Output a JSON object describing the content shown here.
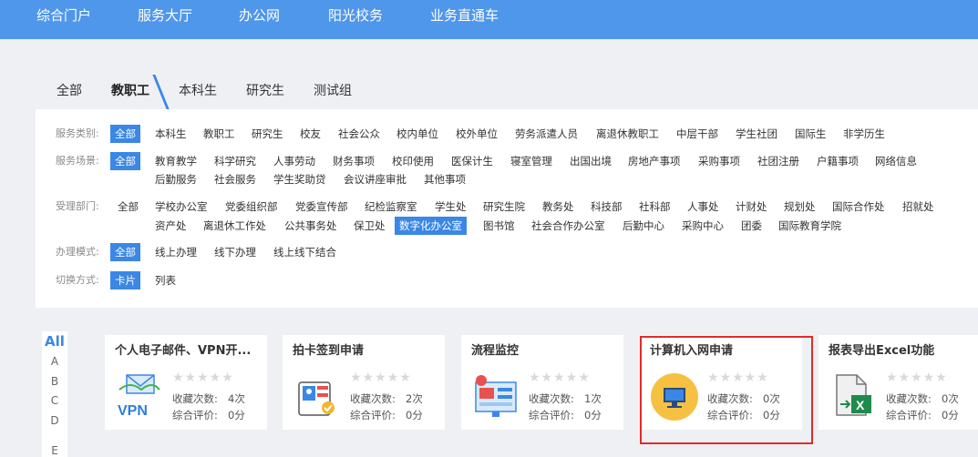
{
  "topnav": {
    "items": [
      "综合门户",
      "服务大厅",
      "办公网",
      "阳光校务",
      "业务直通车"
    ]
  },
  "tabs": [
    "全部",
    "教职工",
    "本科生",
    "研究生",
    "测试组"
  ],
  "filters": {
    "service_category": {
      "label": "服务类别:",
      "options": [
        "全部",
        "本科生",
        "教职工",
        "研究生",
        "校友",
        "社会公众",
        "校内单位",
        "校外单位",
        "劳务派遣人员",
        "离退休教职工",
        "中层干部",
        "学生社团",
        "国际生",
        "非学历生"
      ]
    },
    "service_scene": {
      "label": "服务场景:",
      "options": [
        "全部",
        "教育教学",
        "科学研究",
        "人事劳动",
        "财务事项",
        "校印使用",
        "医保计生",
        "寝室管理",
        "出国出境",
        "房地产事项",
        "采购事项",
        "社团注册",
        "户籍事项",
        "网络信息",
        "后勤服务",
        "社会服务",
        "学生奖助贷",
        "会议讲座审批",
        "其他事项"
      ]
    },
    "department": {
      "label": "受理部门:",
      "options": [
        "全部",
        "学校办公室",
        "党委组织部",
        "党委宣传部",
        "纪检监察室",
        "学生处",
        "研究生院",
        "教务处",
        "科技部",
        "社科部",
        "人事处",
        "计财处",
        "规划处",
        "国际合作处",
        "招就处",
        "资产处",
        "离退休工作处",
        "公共事务处",
        "保卫处",
        "数字化办公室",
        "图书馆",
        "社会合作办公室",
        "后勤中心",
        "采购中心",
        "团委",
        "国际教育学院"
      ]
    },
    "mode": {
      "label": "办理模式:",
      "options": [
        "全部",
        "线上办理",
        "线下办理",
        "线上线下结合"
      ]
    },
    "view": {
      "label": "切换方式:",
      "options": [
        "卡片",
        "列表"
      ]
    }
  },
  "alphabet": [
    "All",
    "A",
    "B",
    "C",
    "D",
    "E"
  ],
  "cards": [
    {
      "title": "个人电子邮件、VPN开...",
      "icon": "vpn-mail-icon",
      "stars": "★★★★★",
      "fav_label": "收藏次数:",
      "fav_value": "4次",
      "rate_label": "综合评价:",
      "rate_value": "0分"
    },
    {
      "title": "拍卡签到申请",
      "icon": "sign-in-card-icon",
      "stars": "★★★★★",
      "fav_label": "收藏次数:",
      "fav_value": "2次",
      "rate_label": "综合评价:",
      "rate_value": "0分"
    },
    {
      "title": "流程监控",
      "icon": "process-monitor-icon",
      "stars": "★★★★★",
      "fav_label": "收藏次数:",
      "fav_value": "1次",
      "rate_label": "综合评价:",
      "rate_value": "0分"
    },
    {
      "title": "计算机入网申请",
      "icon": "computer-network-icon",
      "stars": "★★★★★",
      "fav_label": "收藏次数:",
      "fav_value": "0次",
      "rate_label": "综合评价:",
      "rate_value": "0分"
    },
    {
      "title": "报表导出Excel功能",
      "icon": "excel-export-icon",
      "stars": "★★★★★",
      "fav_label": "收藏次数:",
      "fav_value": "0次",
      "rate_label": "综合评价:",
      "rate_value": "0分"
    }
  ],
  "colors": {
    "accent": "#3b87e6",
    "nav": "#4f97ea",
    "highlight": "#e02b2b"
  }
}
